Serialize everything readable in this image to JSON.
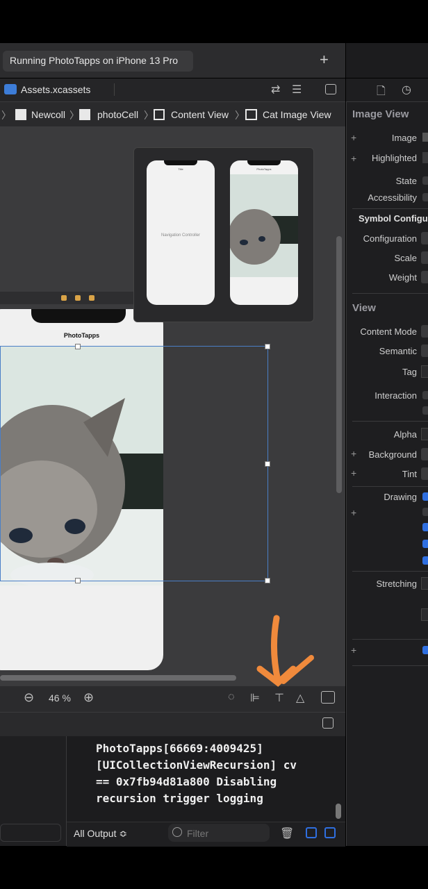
{
  "window": {
    "title": "Running PhotoTapps on iPhone 13 Pro",
    "add_label": "+"
  },
  "tab": {
    "file_name": "Assets.xcassets"
  },
  "breadcrumb": {
    "items": [
      "Newcoll",
      "photoCell",
      "Content View",
      "Cat Image View"
    ]
  },
  "scene_preview": {
    "nav_controller_label": "Navigation Controller",
    "nav_title": "Title",
    "cell_title": "PhotoTapps"
  },
  "canvas": {
    "phone_title": "PhotoTapps",
    "zoom": "46 %"
  },
  "console": {
    "lines": [
      "PhotoTapps[66669:4009425]",
      "[UICollectionViewRecursion] cv",
      "== 0x7fb94d81a800 Disabling",
      "recursion trigger logging"
    ],
    "output_filter": "All Output ≎",
    "filter_placeholder": "Filter"
  },
  "inspector": {
    "image_view_header": "Image View",
    "image_label": "Image",
    "highlighted_label": "Highlighted",
    "state_label": "State",
    "accessibility_label": "Accessibility",
    "symbol_config_header": "Symbol Configu",
    "configuration_label": "Configuration",
    "scale_label": "Scale",
    "weight_label": "Weight",
    "view_header": "View",
    "content_mode_label": "Content Mode",
    "semantic_label": "Semantic",
    "tag_label": "Tag",
    "interaction_label": "Interaction",
    "alpha_label": "Alpha",
    "background_label": "Background",
    "tint_label": "Tint",
    "drawing_label": "Drawing",
    "stretching_label": "Stretching"
  },
  "colors": {
    "accent": "#2f6fe0",
    "annotation_arrow": "#f08a3c",
    "selection": "#4a7fc7"
  }
}
